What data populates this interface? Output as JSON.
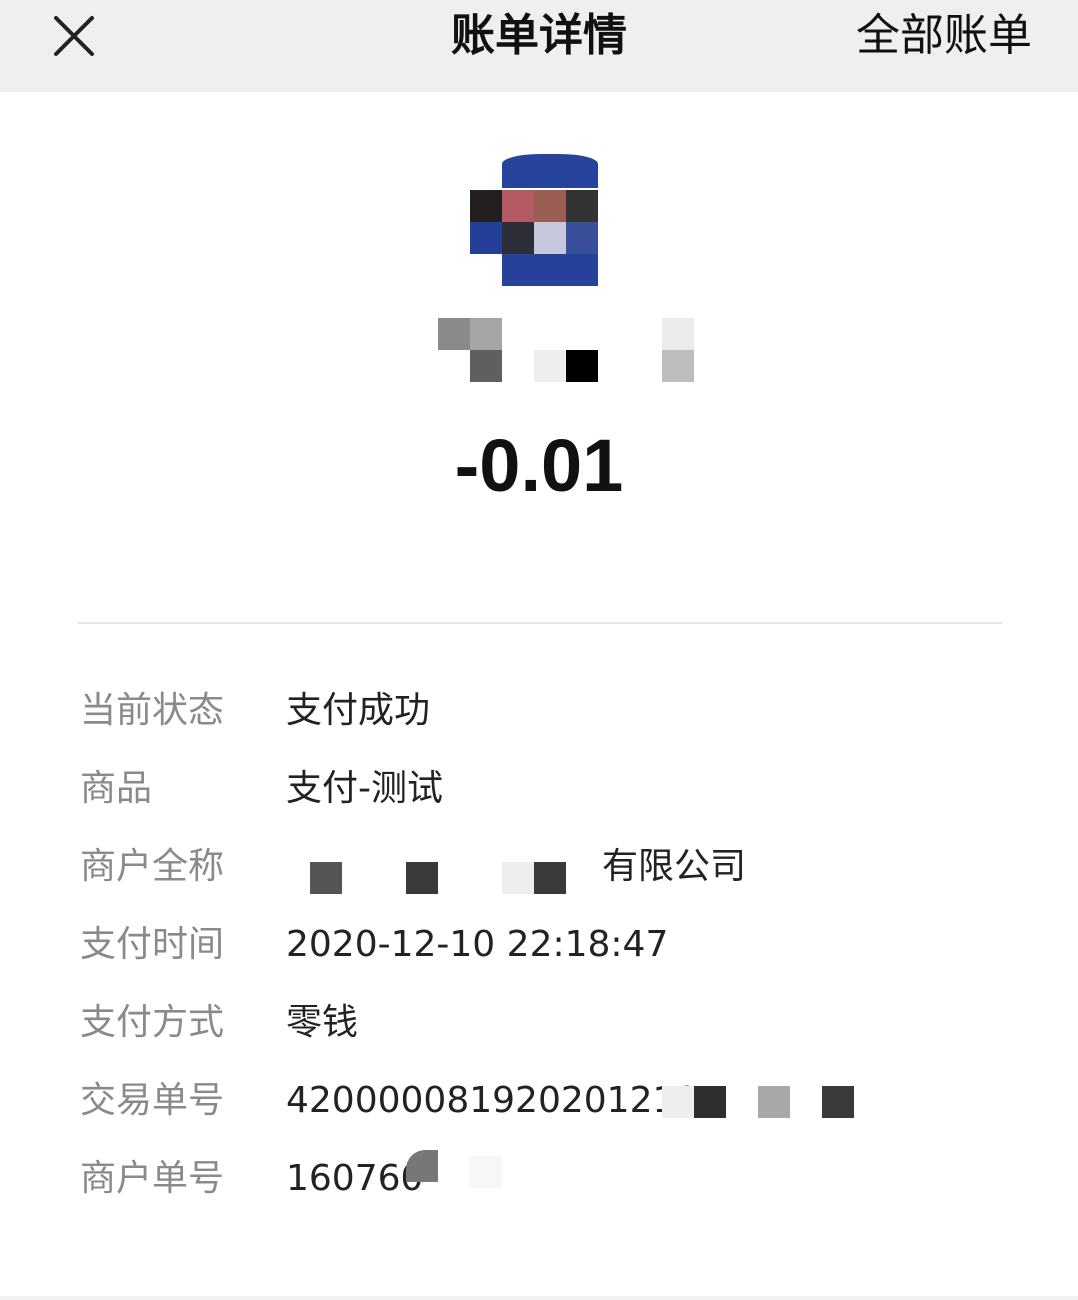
{
  "nav": {
    "title": "账单详情",
    "right_link": "全部账单",
    "close_icon": "close-icon"
  },
  "header": {
    "amount": "-0.01"
  },
  "details": [
    {
      "label": "当前状态",
      "value": "支付成功"
    },
    {
      "label": "商品",
      "value": "支付-测试"
    },
    {
      "label": "商户全称",
      "value": "有限公司"
    },
    {
      "label": "支付时间",
      "value": "2020-12-10 22:18:47"
    },
    {
      "label": "支付方式",
      "value": "零钱"
    },
    {
      "label": "交易单号",
      "value": "420000081920201210"
    },
    {
      "label": "商户单号",
      "value": "160760"
    }
  ],
  "colors": {
    "nav_bg": "#efefef",
    "label": "#8a8a8a",
    "value": "#222222",
    "logo_blue": "#26419a"
  }
}
